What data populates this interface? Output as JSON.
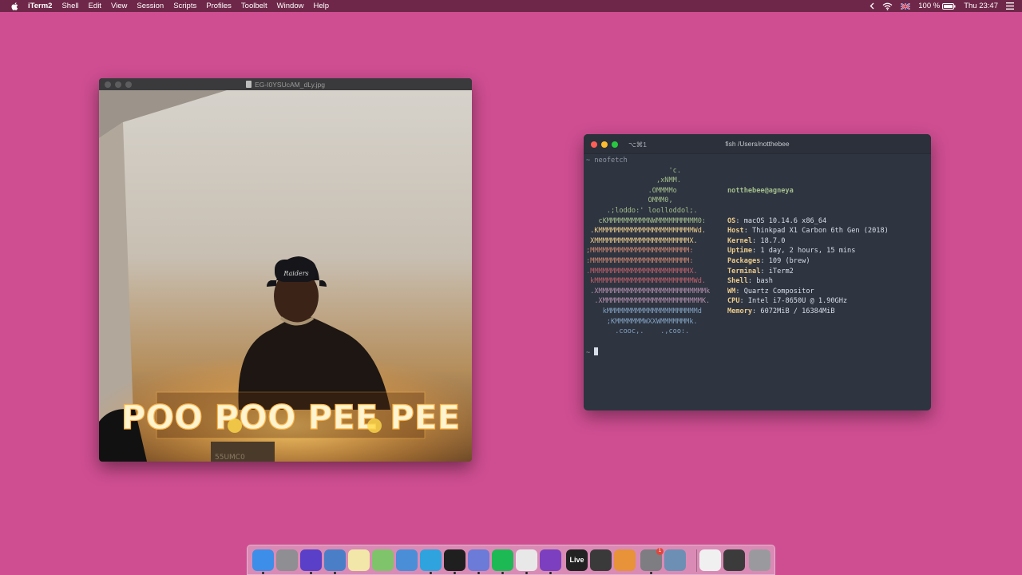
{
  "menubar": {
    "app_name": "iTerm2",
    "items": [
      "Shell",
      "Edit",
      "View",
      "Session",
      "Scripts",
      "Profiles",
      "Toolbelt",
      "Window",
      "Help"
    ],
    "battery": "100 %",
    "clock": "Thu 23:47"
  },
  "preview": {
    "title": "EG-I0YSUcAM_dLy.jpg",
    "photo_sign_text": "POO POO PEE PEE",
    "cap_text": "Raiders",
    "box_text": "55UMC0"
  },
  "terminal": {
    "shortcut": "⌥⌘1",
    "title": "fish /Users/notthebee",
    "command": "~ neofetch",
    "prompt": "~ ",
    "logo_lines": [
      {
        "text": "                    'c.",
        "color": "c1"
      },
      {
        "text": "                 ,xNMM.",
        "color": "c1"
      },
      {
        "text": "               .OMMMMo",
        "color": "c1"
      },
      {
        "text": "               OMMM0,",
        "color": "c1"
      },
      {
        "text": "     .;loddo:' loolloddol;.",
        "color": "c1"
      },
      {
        "text": "   cKMMMMMMMMMMNWMMMMMMMMMM0:",
        "color": "c1"
      },
      {
        "text": " .KMMMMMMMMMMMMMMMMMMMMMMMWd.",
        "color": "c2"
      },
      {
        "text": " XMMMMMMMMMMMMMMMMMMMMMMMX.",
        "color": "c2"
      },
      {
        "text": ";MMMMMMMMMMMMMMMMMMMMMMMM:",
        "color": "c3"
      },
      {
        "text": ":MMMMMMMMMMMMMMMMMMMMMMMM:",
        "color": "c3"
      },
      {
        "text": ".MMMMMMMMMMMMMMMMMMMMMMMMX.",
        "color": "c4"
      },
      {
        "text": " kMMMMMMMMMMMMMMMMMMMMMMMMWd.",
        "color": "c4"
      },
      {
        "text": " .XMMMMMMMMMMMMMMMMMMMMMMMMMMk",
        "color": "c5"
      },
      {
        "text": "  .XMMMMMMMMMMMMMMMMMMMMMMMMK.",
        "color": "c5"
      },
      {
        "text": "    kMMMMMMMMMMMMMMMMMMMMMMd",
        "color": "c6"
      },
      {
        "text": "     ;KMMMMMMMWXXWMMMMMMMk.",
        "color": "c6"
      },
      {
        "text": "       .cooc,.    .,coo:.",
        "color": "c6"
      }
    ],
    "user_host": "notthebee@agneya",
    "info": [
      {
        "key": "OS",
        "value": ": macOS 10.14.6 x86_64"
      },
      {
        "key": "Host",
        "value": ": Thinkpad X1 Carbon 6th Gen (2018)"
      },
      {
        "key": "Kernel",
        "value": ": 18.7.0"
      },
      {
        "key": "Uptime",
        "value": ": 1 day, 2 hours, 15 mins"
      },
      {
        "key": "Packages",
        "value": ": 109 (brew)"
      },
      {
        "key": "Terminal",
        "value": ": iTerm2"
      },
      {
        "key": "Shell",
        "value": ": bash"
      },
      {
        "key": "WM",
        "value": ": Quartz Compositor"
      },
      {
        "key": "CPU",
        "value": ": Intel i7-8650U @ 1.90GHz"
      },
      {
        "key": "Memory",
        "value": ": 6072MiB / 16384MiB"
      }
    ]
  },
  "dock": {
    "apps": [
      {
        "name": "finder-icon",
        "color": "#3d8ee8",
        "running": true
      },
      {
        "name": "launchpad-icon",
        "color": "#8e8e93",
        "running": false
      },
      {
        "name": "firefox-icon",
        "color": "#5a3fc8",
        "running": true
      },
      {
        "name": "preview-icon",
        "color": "#4a7fc8",
        "running": true,
        "badge": ""
      },
      {
        "name": "notes-icon",
        "color": "#f2e7a8",
        "running": false
      },
      {
        "name": "maps-icon",
        "color": "#7fc46a",
        "running": false
      },
      {
        "name": "keychain-icon",
        "color": "#4a8ed8",
        "running": false
      },
      {
        "name": "telegram-icon",
        "color": "#2fa3de",
        "running": true
      },
      {
        "name": "terminal-icon",
        "color": "#1f1f1f",
        "running": true
      },
      {
        "name": "discord-icon",
        "color": "#6c7ad8",
        "running": true
      },
      {
        "name": "spotify-icon",
        "color": "#1db954",
        "running": true
      },
      {
        "name": "keyboard-icon",
        "color": "#e8e8e8",
        "running": true
      },
      {
        "name": "affinity-icon",
        "color": "#7b3fbf",
        "running": true
      },
      {
        "name": "ableton-live-icon",
        "color": "#222222",
        "running": false,
        "label": "Live"
      },
      {
        "name": "final-cut-icon",
        "color": "#3a3a3a",
        "running": false
      },
      {
        "name": "theunarchiver-icon",
        "color": "#e8923a",
        "running": false
      },
      {
        "name": "system-preferences-icon",
        "color": "#7d7d82",
        "running": true,
        "badge": "1"
      },
      {
        "name": "image-capture-icon",
        "color": "#6d8fb4",
        "running": false
      },
      {
        "name": "documents-stack-icon",
        "color": "#f0f0f0",
        "running": false
      },
      {
        "name": "screenshots-stack-icon",
        "color": "#3b3b3b",
        "running": false
      },
      {
        "name": "trash-icon",
        "color": "#9a9a9e",
        "running": false
      }
    ]
  }
}
